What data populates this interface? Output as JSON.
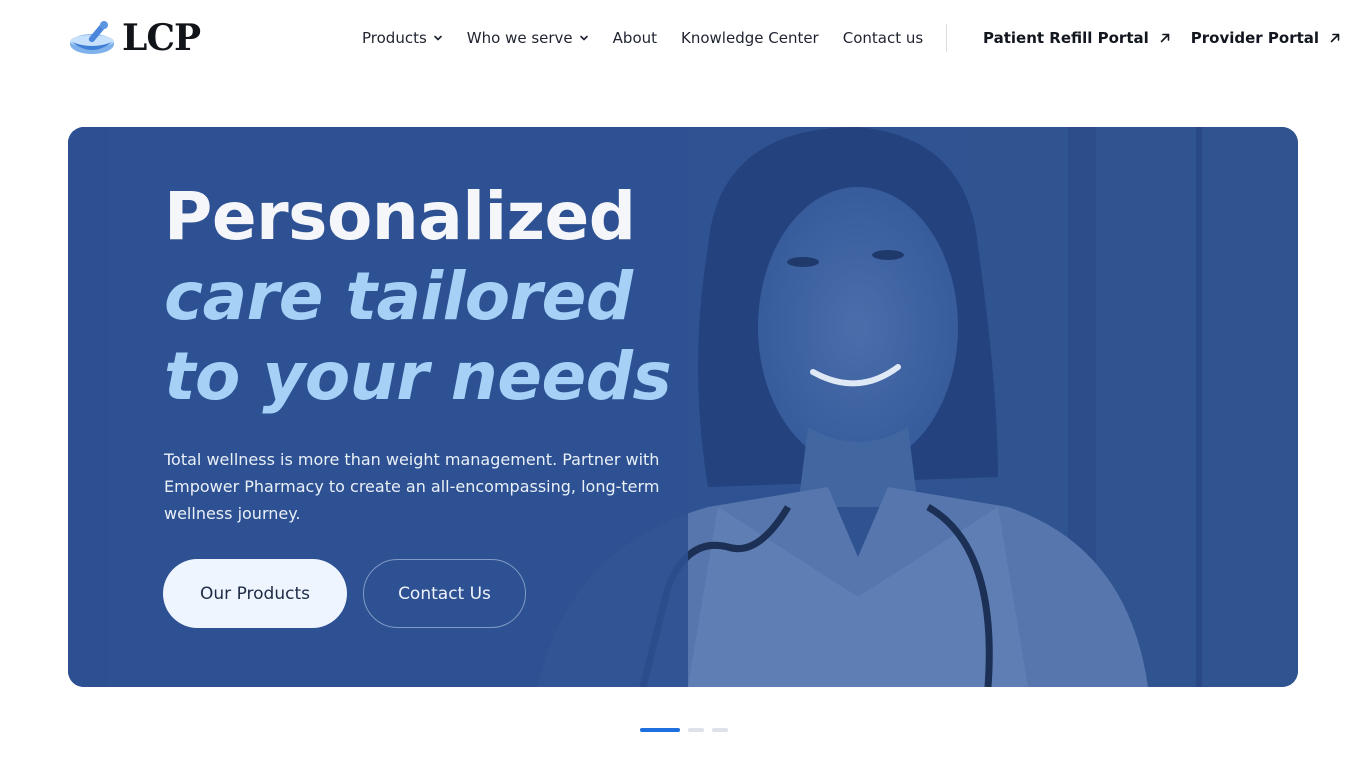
{
  "brand": {
    "name": "LCP"
  },
  "nav": {
    "items": [
      {
        "label": "Products",
        "has_dropdown": true
      },
      {
        "label": "Who we serve",
        "has_dropdown": true
      },
      {
        "label": "About",
        "has_dropdown": false
      },
      {
        "label": "Knowledge Center",
        "has_dropdown": false
      },
      {
        "label": "Contact us",
        "has_dropdown": false
      }
    ],
    "portals": [
      {
        "label": "Patient Refill Portal",
        "icon": "external-arrow-icon"
      },
      {
        "label": "Provider Portal",
        "icon": "external-arrow-icon"
      }
    ]
  },
  "hero": {
    "title_line1": "Personalized",
    "title_line2": "care tailored",
    "title_line3": "to your needs",
    "description": "Total wellness is more than weight management. Partner with Empower Pharmacy to create an all-encompassing, long-term wellness journey.",
    "primary_button": "Our Products",
    "secondary_button": "Contact Us"
  },
  "carousel": {
    "slide_count": 3,
    "active_index": 0
  },
  "colors": {
    "hero_background": "#2f5190",
    "accent_text": "#a7d0f7",
    "pager_active": "#1f6fdf",
    "pager_inactive": "#dde2ea"
  }
}
